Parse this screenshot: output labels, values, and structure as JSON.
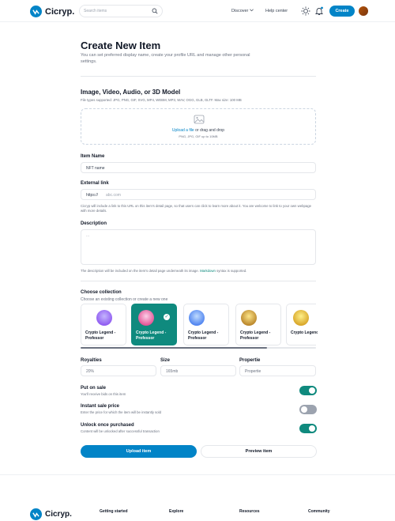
{
  "brand": {
    "name": "Cicryp.",
    "accent": "#0284c7",
    "teal": "#0f8a7e"
  },
  "header": {
    "search_placeholder": "Search items",
    "links": [
      "Discover",
      "Help center"
    ],
    "create_label": "Create"
  },
  "page": {
    "title": "Create New Item",
    "subtitle": "You can set preferred display name, create your profile URL and manage other personal settings."
  },
  "upload": {
    "heading": "Image, Video, Audio, or 3D Model",
    "types": "File types supported: JPG, PNG, GIF, SVG, MP4, WEBM, MP3, WAV, OGG, GLB, GLTF. Max size: 100 MB",
    "link_text": "Upload a file",
    "drag_text": " or drag and drop",
    "formats": "PNG, JPG, GIF up to 10MB"
  },
  "item_name": {
    "label": "Item Name",
    "value": "NFT name"
  },
  "external_link": {
    "label": "External link",
    "prefix": "https://",
    "value": "abc.com",
    "help": "Cicryp will include a link to this URL on this item's detail page, so that users can click to learn more about it. You are welcome to link to your own webpage with more details."
  },
  "description": {
    "label": "Description",
    "placeholder": "...",
    "help_before": "The description will be included on the item's detail page underneath its image. ",
    "help_link": "Markdown",
    "help_after": " syntax is supported."
  },
  "collection": {
    "title": "Choose collection",
    "subtitle": "Choose an existing collection or create a new one",
    "cards": [
      {
        "name": "Crypto Legend - Professor",
        "selected": false,
        "color": "#7c3aed"
      },
      {
        "name": "Crypto Legend - Professor",
        "selected": true,
        "color": "#db2777"
      },
      {
        "name": "Crypto Legend - Professor",
        "selected": false,
        "color": "#2563eb"
      },
      {
        "name": "Crypto Legend - Professor",
        "selected": false,
        "color": "#a16207"
      },
      {
        "name": "Crypto Legend - Professor",
        "selected": false,
        "color": "#ca8a04"
      }
    ],
    "check_glyph": "✓"
  },
  "fields": [
    {
      "label": "Royalties",
      "placeholder": "20%"
    },
    {
      "label": "Size",
      "placeholder": "165mb"
    },
    {
      "label": "Propertie",
      "placeholder": "Propertie"
    }
  ],
  "toggles": [
    {
      "title": "Put on sale",
      "desc": "You'll receive bids on this item",
      "on": true
    },
    {
      "title": "Instant sale price",
      "desc": "Enter the price for which the item will be instantly sold",
      "on": false
    },
    {
      "title": "Unlock once purchased",
      "desc": "Content will be unlocked after successful transaction",
      "on": true
    }
  ],
  "actions": {
    "upload": "Upload item",
    "preview": "Preview item"
  },
  "footer": {
    "logo": "Cicryp.",
    "columns": [
      "Getting started",
      "Explore",
      "Resources",
      "Community"
    ]
  },
  "icons": [
    "logo-mark-icon",
    "search-icon",
    "chevron-down-icon",
    "sun-icon",
    "bell-icon",
    "image-icon",
    "check-icon"
  ]
}
